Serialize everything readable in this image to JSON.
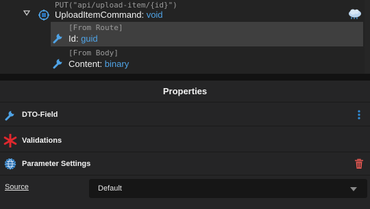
{
  "tree": {
    "command": {
      "annotation": "PUT(\"api/upload-item/{id}\")",
      "name": "UploadItemCommand",
      "separator": ": ",
      "return_type": "void"
    },
    "properties": [
      {
        "annotation": "[From Route]",
        "name": "Id",
        "separator": ": ",
        "type": "guid",
        "selected": true
      },
      {
        "annotation": "[From Body]",
        "name": "Content",
        "separator": ": ",
        "type": "binary",
        "selected": false
      }
    ]
  },
  "properties_panel": {
    "title": "Properties",
    "sections": {
      "dto_field": "DTO-Field",
      "validations": "Validations",
      "parameter_settings": "Parameter Settings"
    },
    "source": {
      "label": "Source",
      "value": "Default"
    }
  },
  "colors": {
    "accent_blue": "#4fa3e6",
    "validation_red": "#e0282e",
    "trash_red": "#d9544f",
    "selected_row": "#3f3f3f"
  },
  "icons": [
    "chevron-down-icon",
    "command-icon",
    "cloud-service-icon",
    "wrench-icon",
    "asterisk-icon",
    "gear-globe-icon",
    "kebab-menu-icon",
    "trash-icon",
    "dropdown-caret-icon"
  ]
}
